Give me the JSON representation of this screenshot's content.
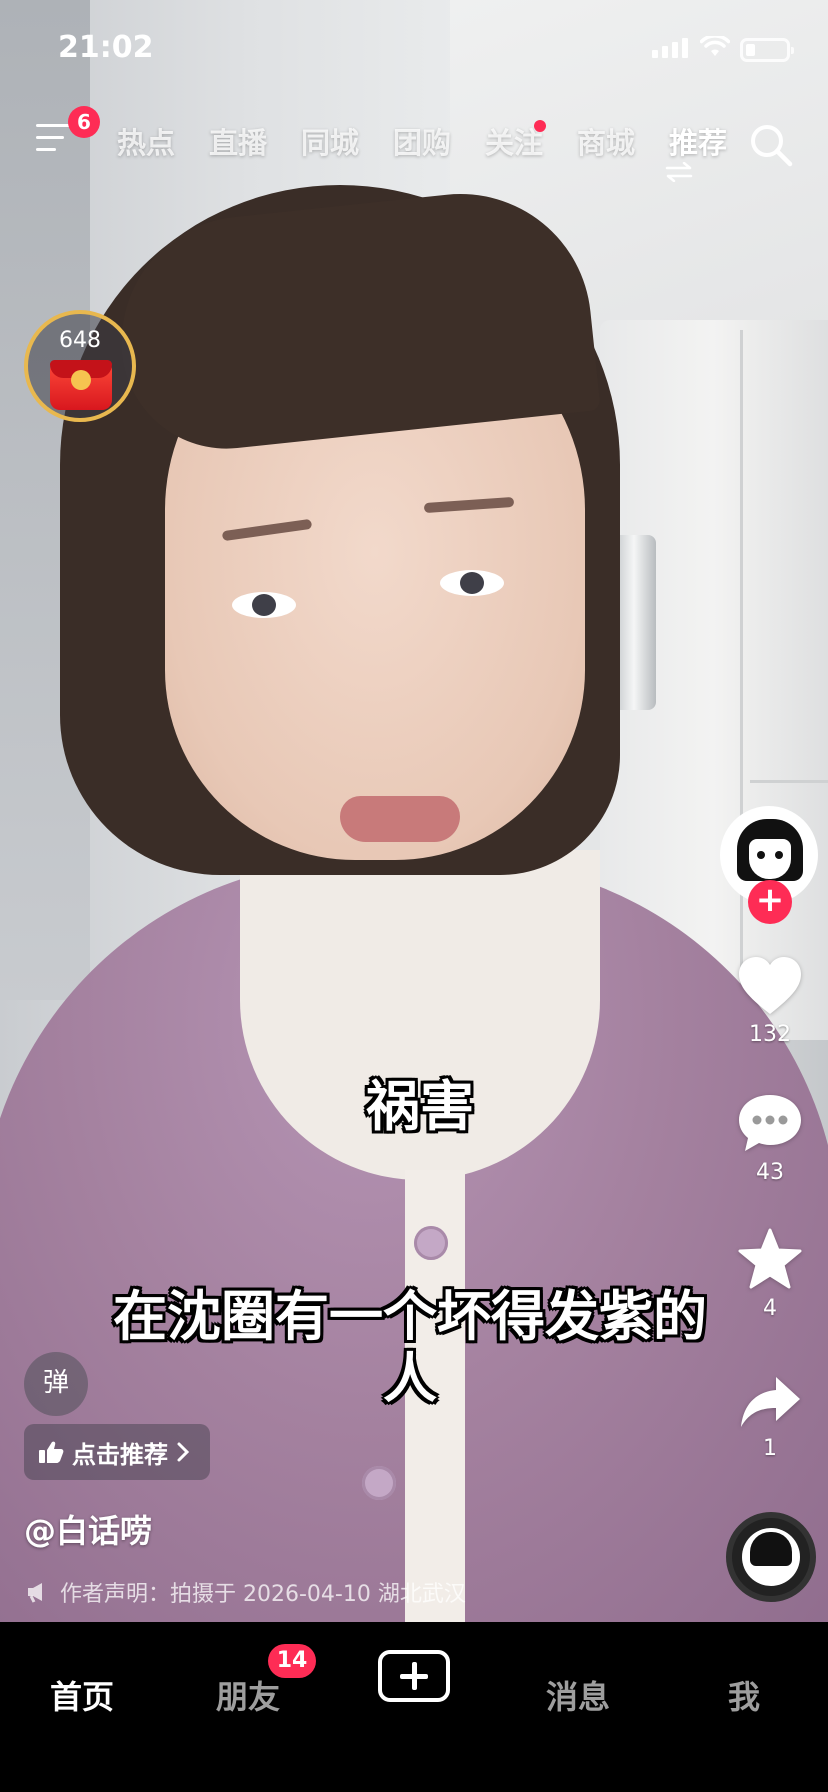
{
  "status_bar": {
    "time": "21:02"
  },
  "top_nav": {
    "menu_badge": "6",
    "tabs": [
      {
        "label": "热点"
      },
      {
        "label": "直播"
      },
      {
        "label": "同城"
      },
      {
        "label": "团购"
      },
      {
        "label": "关注"
      },
      {
        "label": "商城"
      },
      {
        "label": "推荐"
      }
    ],
    "active_tab": "推荐"
  },
  "red_packet": {
    "count": "648"
  },
  "actions": {
    "likes": "132",
    "comments": "43",
    "favorites": "4",
    "shares": "1"
  },
  "captions": {
    "line1": "祸害",
    "line2": "在沈圈有一个坏得发紫的人"
  },
  "info": {
    "danmu_label": "弹",
    "recommend_label": "点击推荐",
    "author": "@白话唠",
    "declaration": "作者声明：拍摄于 2026-04-10 湖北武汉"
  },
  "bottom_bar": {
    "home": "首页",
    "friends": "朋友",
    "friends_badge": "14",
    "messages": "消息",
    "me": "我"
  },
  "colors": {
    "accent": "#fe2c55",
    "packet_ring": "#e8b84f"
  }
}
